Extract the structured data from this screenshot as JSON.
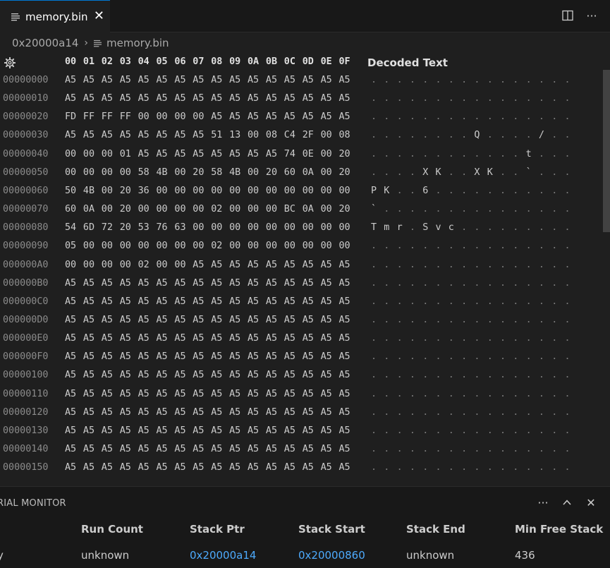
{
  "tab": {
    "title": "memory.bin",
    "close_glyph": "✕"
  },
  "tab_actions": [
    {
      "name": "split-editor-icon"
    },
    {
      "name": "more-actions-icon",
      "glyph": "···"
    }
  ],
  "breadcrumb": {
    "segment1": "0x20000a14",
    "separator": "›",
    "segment2": "memory.bin"
  },
  "hex": {
    "column_headers": [
      "00",
      "01",
      "02",
      "03",
      "04",
      "05",
      "06",
      "07",
      "08",
      "09",
      "0A",
      "0B",
      "0C",
      "0D",
      "0E",
      "0F"
    ],
    "decoded_header": "Decoded Text",
    "rows": [
      {
        "addr": "00000000",
        "bytes": [
          "A5",
          "A5",
          "A5",
          "A5",
          "A5",
          "A5",
          "A5",
          "A5",
          "A5",
          "A5",
          "A5",
          "A5",
          "A5",
          "A5",
          "A5",
          "A5"
        ],
        "decoded": [
          ".",
          ".",
          ".",
          ".",
          ".",
          ".",
          ".",
          ".",
          ".",
          ".",
          ".",
          ".",
          ".",
          ".",
          ".",
          "."
        ]
      },
      {
        "addr": "00000010",
        "bytes": [
          "A5",
          "A5",
          "A5",
          "A5",
          "A5",
          "A5",
          "A5",
          "A5",
          "A5",
          "A5",
          "A5",
          "A5",
          "A5",
          "A5",
          "A5",
          "A5"
        ],
        "decoded": [
          ".",
          ".",
          ".",
          ".",
          ".",
          ".",
          ".",
          ".",
          ".",
          ".",
          ".",
          ".",
          ".",
          ".",
          ".",
          "."
        ]
      },
      {
        "addr": "00000020",
        "bytes": [
          "FD",
          "FF",
          "FF",
          "FF",
          "00",
          "00",
          "00",
          "00",
          "A5",
          "A5",
          "A5",
          "A5",
          "A5",
          "A5",
          "A5",
          "A5"
        ],
        "decoded": [
          ".",
          ".",
          ".",
          ".",
          ".",
          ".",
          ".",
          ".",
          ".",
          ".",
          ".",
          ".",
          ".",
          ".",
          ".",
          "."
        ]
      },
      {
        "addr": "00000030",
        "bytes": [
          "A5",
          "A5",
          "A5",
          "A5",
          "A5",
          "A5",
          "A5",
          "A5",
          "51",
          "13",
          "00",
          "08",
          "C4",
          "2F",
          "00",
          "08"
        ],
        "decoded": [
          ".",
          ".",
          ".",
          ".",
          ".",
          ".",
          ".",
          ".",
          "Q",
          ".",
          ".",
          ".",
          ".",
          "/",
          ".",
          "."
        ]
      },
      {
        "addr": "00000040",
        "bytes": [
          "00",
          "00",
          "00",
          "01",
          "A5",
          "A5",
          "A5",
          "A5",
          "A5",
          "A5",
          "A5",
          "A5",
          "74",
          "0E",
          "00",
          "20"
        ],
        "decoded": [
          ".",
          ".",
          ".",
          ".",
          ".",
          ".",
          ".",
          ".",
          ".",
          ".",
          ".",
          ".",
          "t",
          ".",
          ".",
          "."
        ]
      },
      {
        "addr": "00000050",
        "bytes": [
          "00",
          "00",
          "00",
          "00",
          "58",
          "4B",
          "00",
          "20",
          "58",
          "4B",
          "00",
          "20",
          "60",
          "0A",
          "00",
          "20"
        ],
        "decoded": [
          ".",
          ".",
          ".",
          ".",
          "X",
          "K",
          ".",
          ".",
          "X",
          "K",
          ".",
          ".",
          "`",
          ".",
          ".",
          "."
        ]
      },
      {
        "addr": "00000060",
        "bytes": [
          "50",
          "4B",
          "00",
          "20",
          "36",
          "00",
          "00",
          "00",
          "00",
          "00",
          "00",
          "00",
          "00",
          "00",
          "00",
          "00"
        ],
        "decoded": [
          "P",
          "K",
          ".",
          ".",
          "6",
          ".",
          ".",
          ".",
          ".",
          ".",
          ".",
          ".",
          ".",
          ".",
          ".",
          "."
        ]
      },
      {
        "addr": "00000070",
        "bytes": [
          "60",
          "0A",
          "00",
          "20",
          "00",
          "00",
          "00",
          "00",
          "02",
          "00",
          "00",
          "00",
          "BC",
          "0A",
          "00",
          "20"
        ],
        "decoded": [
          "`",
          ".",
          ".",
          ".",
          ".",
          ".",
          ".",
          ".",
          ".",
          ".",
          ".",
          ".",
          ".",
          ".",
          ".",
          "."
        ]
      },
      {
        "addr": "00000080",
        "bytes": [
          "54",
          "6D",
          "72",
          "20",
          "53",
          "76",
          "63",
          "00",
          "00",
          "00",
          "00",
          "00",
          "00",
          "00",
          "00",
          "00"
        ],
        "decoded": [
          "T",
          "m",
          "r",
          ".",
          "S",
          "v",
          "c",
          ".",
          ".",
          ".",
          ".",
          ".",
          ".",
          ".",
          ".",
          "."
        ]
      },
      {
        "addr": "00000090",
        "bytes": [
          "05",
          "00",
          "00",
          "00",
          "00",
          "00",
          "00",
          "00",
          "02",
          "00",
          "00",
          "00",
          "00",
          "00",
          "00",
          "00"
        ],
        "decoded": [
          ".",
          ".",
          ".",
          ".",
          ".",
          ".",
          ".",
          ".",
          ".",
          ".",
          ".",
          ".",
          ".",
          ".",
          ".",
          "."
        ]
      },
      {
        "addr": "000000A0",
        "bytes": [
          "00",
          "00",
          "00",
          "00",
          "02",
          "00",
          "00",
          "A5",
          "A5",
          "A5",
          "A5",
          "A5",
          "A5",
          "A5",
          "A5",
          "A5"
        ],
        "decoded": [
          ".",
          ".",
          ".",
          ".",
          ".",
          ".",
          ".",
          ".",
          ".",
          ".",
          ".",
          ".",
          ".",
          ".",
          ".",
          "."
        ]
      },
      {
        "addr": "000000B0",
        "bytes": [
          "A5",
          "A5",
          "A5",
          "A5",
          "A5",
          "A5",
          "A5",
          "A5",
          "A5",
          "A5",
          "A5",
          "A5",
          "A5",
          "A5",
          "A5",
          "A5"
        ],
        "decoded": [
          ".",
          ".",
          ".",
          ".",
          ".",
          ".",
          ".",
          ".",
          ".",
          ".",
          ".",
          ".",
          ".",
          ".",
          ".",
          "."
        ]
      },
      {
        "addr": "000000C0",
        "bytes": [
          "A5",
          "A5",
          "A5",
          "A5",
          "A5",
          "A5",
          "A5",
          "A5",
          "A5",
          "A5",
          "A5",
          "A5",
          "A5",
          "A5",
          "A5",
          "A5"
        ],
        "decoded": [
          ".",
          ".",
          ".",
          ".",
          ".",
          ".",
          ".",
          ".",
          ".",
          ".",
          ".",
          ".",
          ".",
          ".",
          ".",
          "."
        ]
      },
      {
        "addr": "000000D0",
        "bytes": [
          "A5",
          "A5",
          "A5",
          "A5",
          "A5",
          "A5",
          "A5",
          "A5",
          "A5",
          "A5",
          "A5",
          "A5",
          "A5",
          "A5",
          "A5",
          "A5"
        ],
        "decoded": [
          ".",
          ".",
          ".",
          ".",
          ".",
          ".",
          ".",
          ".",
          ".",
          ".",
          ".",
          ".",
          ".",
          ".",
          ".",
          "."
        ]
      },
      {
        "addr": "000000E0",
        "bytes": [
          "A5",
          "A5",
          "A5",
          "A5",
          "A5",
          "A5",
          "A5",
          "A5",
          "A5",
          "A5",
          "A5",
          "A5",
          "A5",
          "A5",
          "A5",
          "A5"
        ],
        "decoded": [
          ".",
          ".",
          ".",
          ".",
          ".",
          ".",
          ".",
          ".",
          ".",
          ".",
          ".",
          ".",
          ".",
          ".",
          ".",
          "."
        ]
      },
      {
        "addr": "000000F0",
        "bytes": [
          "A5",
          "A5",
          "A5",
          "A5",
          "A5",
          "A5",
          "A5",
          "A5",
          "A5",
          "A5",
          "A5",
          "A5",
          "A5",
          "A5",
          "A5",
          "A5"
        ],
        "decoded": [
          ".",
          ".",
          ".",
          ".",
          ".",
          ".",
          ".",
          ".",
          ".",
          ".",
          ".",
          ".",
          ".",
          ".",
          ".",
          "."
        ]
      },
      {
        "addr": "00000100",
        "bytes": [
          "A5",
          "A5",
          "A5",
          "A5",
          "A5",
          "A5",
          "A5",
          "A5",
          "A5",
          "A5",
          "A5",
          "A5",
          "A5",
          "A5",
          "A5",
          "A5"
        ],
        "decoded": [
          ".",
          ".",
          ".",
          ".",
          ".",
          ".",
          ".",
          ".",
          ".",
          ".",
          ".",
          ".",
          ".",
          ".",
          ".",
          "."
        ]
      },
      {
        "addr": "00000110",
        "bytes": [
          "A5",
          "A5",
          "A5",
          "A5",
          "A5",
          "A5",
          "A5",
          "A5",
          "A5",
          "A5",
          "A5",
          "A5",
          "A5",
          "A5",
          "A5",
          "A5"
        ],
        "decoded": [
          ".",
          ".",
          ".",
          ".",
          ".",
          ".",
          ".",
          ".",
          ".",
          ".",
          ".",
          ".",
          ".",
          ".",
          ".",
          "."
        ]
      },
      {
        "addr": "00000120",
        "bytes": [
          "A5",
          "A5",
          "A5",
          "A5",
          "A5",
          "A5",
          "A5",
          "A5",
          "A5",
          "A5",
          "A5",
          "A5",
          "A5",
          "A5",
          "A5",
          "A5"
        ],
        "decoded": [
          ".",
          ".",
          ".",
          ".",
          ".",
          ".",
          ".",
          ".",
          ".",
          ".",
          ".",
          ".",
          ".",
          ".",
          ".",
          "."
        ]
      },
      {
        "addr": "00000130",
        "bytes": [
          "A5",
          "A5",
          "A5",
          "A5",
          "A5",
          "A5",
          "A5",
          "A5",
          "A5",
          "A5",
          "A5",
          "A5",
          "A5",
          "A5",
          "A5",
          "A5"
        ],
        "decoded": [
          ".",
          ".",
          ".",
          ".",
          ".",
          ".",
          ".",
          ".",
          ".",
          ".",
          ".",
          ".",
          ".",
          ".",
          ".",
          "."
        ]
      },
      {
        "addr": "00000140",
        "bytes": [
          "A5",
          "A5",
          "A5",
          "A5",
          "A5",
          "A5",
          "A5",
          "A5",
          "A5",
          "A5",
          "A5",
          "A5",
          "A5",
          "A5",
          "A5",
          "A5"
        ],
        "decoded": [
          ".",
          ".",
          ".",
          ".",
          ".",
          ".",
          ".",
          ".",
          ".",
          ".",
          ".",
          ".",
          ".",
          ".",
          ".",
          "."
        ]
      },
      {
        "addr": "00000150",
        "bytes": [
          "A5",
          "A5",
          "A5",
          "A5",
          "A5",
          "A5",
          "A5",
          "A5",
          "A5",
          "A5",
          "A5",
          "A5",
          "A5",
          "A5",
          "A5",
          "A5"
        ],
        "decoded": [
          ".",
          ".",
          ".",
          ".",
          ".",
          ".",
          ".",
          ".",
          ".",
          ".",
          ".",
          ".",
          ".",
          ".",
          ".",
          "."
        ]
      }
    ]
  },
  "panel": {
    "title": "RIAL MONITOR",
    "actions": [
      {
        "name": "more-actions-icon",
        "glyph": "···"
      },
      {
        "name": "maximize-panel-icon",
        "glyph": "∧"
      },
      {
        "name": "close-panel-icon",
        "glyph": "✕"
      }
    ],
    "table": {
      "lead_cell": "y",
      "headers": [
        "Run Count",
        "Stack Ptr",
        "Stack Start",
        "Stack End",
        "Min Free Stack"
      ],
      "values": [
        "unknown",
        "0x20000a14",
        "0x20000860",
        "unknown",
        "436"
      ],
      "link_values": [
        false,
        true,
        true,
        false,
        false
      ]
    }
  },
  "colors": {
    "accent": "#0078d4",
    "link": "#4daafc",
    "background": "#1f1f1f",
    "panel_background": "#181818"
  }
}
